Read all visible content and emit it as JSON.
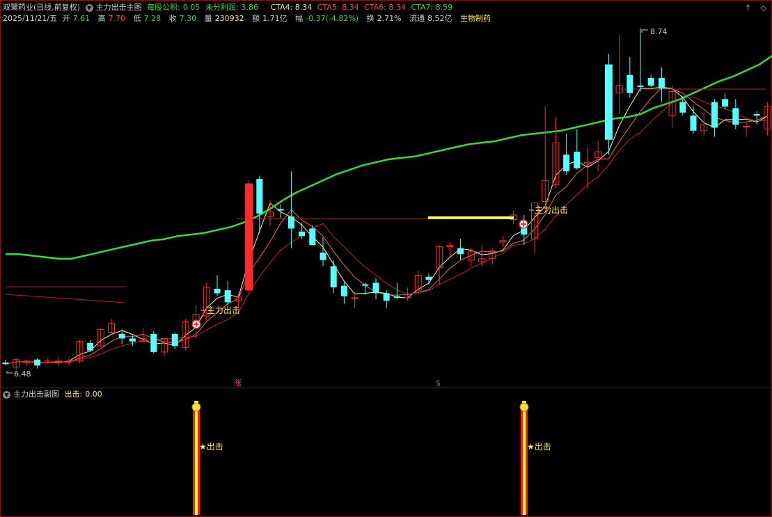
{
  "header": {
    "stock_name": "双鹭药业(日线,前复权)",
    "indicator_name": "主力出击主图",
    "eps_label": "每股公积:",
    "eps_value": "0.05",
    "undist_label": "未分利润:",
    "undist_value": "3.86",
    "cta4": "CTA4: 8.34",
    "cta5": "CTA5: 8.34",
    "cta6": "CTA6: 8.34",
    "cta7": "CTA7: 8.59",
    "right_icons": [
      "↑",
      "◇"
    ]
  },
  "quote": {
    "date": "2025/11/21/五",
    "open_label": "开",
    "open": "7.61",
    "high_label": "高",
    "high": "7.70",
    "low_label": "低",
    "low": "7.28",
    "close_label": "收",
    "close": "7.30",
    "vol_label": "量",
    "vol": "230932",
    "amount_label": "额",
    "amount": "1.71亿",
    "chg_label": "幅",
    "chg": "-0.37(-4.82%)",
    "turnover_label": "换",
    "turnover": "2.71%",
    "float_label": "流通",
    "float": "8.52亿",
    "sector": "生物制药"
  },
  "main_chart": {
    "max_label": "8.74",
    "min_label": "6.48",
    "signal_text": "主力出击",
    "marker_zhang": "涨",
    "marker_s": "$"
  },
  "sub_chart": {
    "title": "主力出击副图",
    "value_label": "出击:",
    "value": "0.00",
    "signal_text": "★出击"
  },
  "colors": {
    "up": "#ff2a2a",
    "down": "#54ffff",
    "ma_green": "#33dd33",
    "yellow": "#ffff33",
    "frame": "#8a1010"
  },
  "chart_data": {
    "type": "candlestick",
    "ylim": [
      6.35,
      8.85
    ],
    "candles": [
      [
        6.54,
        6.56,
        6.52,
        6.53
      ],
      [
        6.51,
        6.57,
        6.49,
        6.56
      ],
      [
        6.54,
        6.56,
        6.52,
        6.55
      ],
      [
        6.56,
        6.57,
        6.5,
        6.52
      ],
      [
        6.54,
        6.57,
        6.53,
        6.55
      ],
      [
        6.55,
        6.58,
        6.52,
        6.55
      ],
      [
        6.54,
        6.57,
        6.52,
        6.55
      ],
      [
        6.55,
        6.69,
        6.54,
        6.68
      ],
      [
        6.67,
        6.69,
        6.61,
        6.62
      ],
      [
        6.65,
        6.77,
        6.64,
        6.76
      ],
      [
        6.74,
        6.83,
        6.72,
        6.8
      ],
      [
        6.73,
        6.76,
        6.66,
        6.7
      ],
      [
        6.7,
        6.72,
        6.65,
        6.68
      ],
      [
        6.68,
        6.77,
        6.67,
        6.7
      ],
      [
        6.73,
        6.75,
        6.6,
        6.61
      ],
      [
        6.61,
        6.7,
        6.58,
        6.7
      ],
      [
        6.73,
        6.74,
        6.63,
        6.65
      ],
      [
        6.64,
        6.83,
        6.62,
        6.81
      ],
      [
        6.78,
        6.92,
        6.7,
        6.86
      ],
      [
        6.85,
        7.07,
        6.81,
        7.04
      ],
      [
        7.03,
        7.12,
        6.98,
        7.0
      ],
      [
        7.02,
        7.08,
        6.92,
        6.94
      ],
      [
        6.95,
        7.0,
        6.9,
        6.98
      ],
      [
        7.02,
        7.75,
        7.01,
        7.73
      ],
      [
        7.76,
        7.78,
        7.4,
        7.53
      ],
      [
        7.51,
        7.62,
        7.45,
        7.54
      ],
      [
        7.56,
        7.59,
        7.5,
        7.55
      ],
      [
        7.51,
        7.81,
        7.3,
        7.43
      ],
      [
        7.41,
        7.47,
        7.36,
        7.38
      ],
      [
        7.43,
        7.45,
        7.32,
        7.32
      ],
      [
        7.27,
        7.37,
        7.18,
        7.22
      ],
      [
        7.18,
        7.22,
        7.0,
        7.04
      ],
      [
        7.05,
        7.08,
        6.93,
        6.98
      ],
      [
        6.97,
        7.01,
        6.9,
        6.97
      ],
      [
        7.06,
        7.07,
        6.99,
        7.05
      ],
      [
        7.07,
        7.1,
        6.96,
        7.0
      ],
      [
        7.0,
        7.02,
        6.9,
        6.95
      ],
      [
        6.98,
        7.07,
        6.96,
        6.97
      ],
      [
        6.97,
        7.04,
        6.95,
        6.99
      ],
      [
        7.02,
        7.15,
        7.01,
        7.12
      ],
      [
        7.11,
        7.13,
        7.06,
        7.09
      ],
      [
        7.17,
        7.32,
        7.06,
        7.31
      ],
      [
        7.31,
        7.34,
        7.24,
        7.32
      ],
      [
        7.3,
        7.36,
        7.22,
        7.26
      ],
      [
        7.22,
        7.3,
        7.18,
        7.28
      ],
      [
        7.21,
        7.32,
        7.18,
        7.23
      ],
      [
        7.23,
        7.3,
        7.19,
        7.28
      ],
      [
        7.34,
        7.38,
        7.31,
        7.35
      ],
      [
        7.49,
        7.55,
        7.46,
        7.52
      ],
      [
        7.48,
        7.52,
        7.32,
        7.39
      ],
      [
        7.36,
        7.54,
        7.27,
        7.6
      ],
      [
        7.61,
        8.24,
        7.54,
        7.75
      ],
      [
        7.72,
        8.17,
        7.7,
        8.0
      ],
      [
        7.92,
        8.06,
        7.79,
        7.81
      ],
      [
        7.94,
        8.09,
        7.82,
        7.83
      ],
      [
        7.86,
        7.97,
        7.69,
        7.87
      ],
      [
        7.9,
        8.01,
        7.81,
        7.94
      ],
      [
        8.52,
        8.59,
        7.92,
        8.02
      ],
      [
        8.33,
        8.72,
        8.19,
        8.38
      ],
      [
        8.45,
        8.57,
        8.3,
        8.33
      ],
      [
        8.38,
        8.76,
        8.34,
        8.37
      ],
      [
        8.43,
        8.45,
        8.37,
        8.38
      ],
      [
        8.43,
        8.5,
        8.27,
        8.36
      ],
      [
        8.18,
        8.38,
        8.1,
        8.34
      ],
      [
        8.27,
        8.31,
        8.18,
        8.2
      ],
      [
        8.18,
        8.24,
        8.06,
        8.08
      ],
      [
        8.08,
        8.2,
        8.05,
        8.12
      ],
      [
        8.27,
        8.29,
        8.04,
        8.1
      ],
      [
        8.29,
        8.33,
        8.22,
        8.24
      ],
      [
        8.23,
        8.29,
        8.09,
        8.12
      ],
      [
        8.11,
        8.14,
        8.04,
        8.11
      ],
      [
        8.19,
        8.21,
        8.12,
        8.18
      ],
      [
        8.09,
        8.27,
        8.05,
        8.24
      ]
    ],
    "ma_green": {
      "start_idx": 0,
      "values": [
        7.26,
        7.26,
        7.25,
        7.24,
        7.23,
        7.23,
        7.25,
        7.27,
        7.29,
        7.31,
        7.33,
        7.35,
        7.36,
        7.38,
        7.39,
        7.4,
        7.42,
        7.44,
        7.47,
        7.51,
        7.56,
        7.62,
        7.67,
        7.71,
        7.75,
        7.79,
        7.82,
        7.85,
        7.87,
        7.89,
        7.9,
        7.91,
        7.93,
        7.95,
        7.97,
        7.99,
        8.0,
        8.01,
        8.03,
        8.05,
        8.06,
        8.07,
        8.08,
        8.1,
        8.12,
        8.14,
        8.16,
        8.17,
        8.19,
        8.23,
        8.26,
        8.29,
        8.33,
        8.37,
        8.41,
        8.44,
        8.48,
        8.52,
        8.58
      ]
    }
  }
}
